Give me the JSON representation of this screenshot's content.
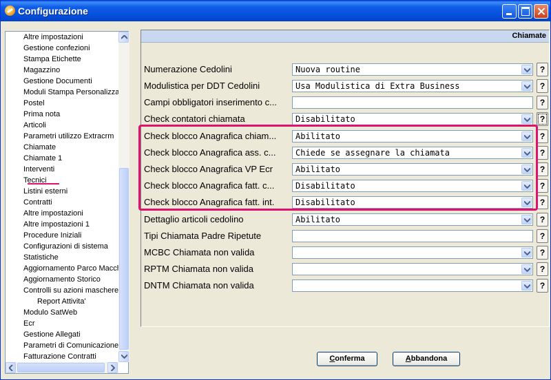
{
  "window": {
    "title": "Configurazione",
    "icon": "app-icon"
  },
  "tree": {
    "items": [
      {
        "label": "Altre impostazioni"
      },
      {
        "label": "Gestione confezioni"
      },
      {
        "label": "Stampa Etichette"
      },
      {
        "label": "Magazzino"
      },
      {
        "label": "Gestione Documenti"
      },
      {
        "label": "Moduli Stampa Personalizzat"
      },
      {
        "label": "Postel"
      },
      {
        "label": "Prima nota"
      },
      {
        "label": "Articoli"
      },
      {
        "label": "Parametri utilizzo Extracrm"
      },
      {
        "label": "Chiamate"
      },
      {
        "label": "Chiamate 1"
      },
      {
        "label": "Interventi"
      },
      {
        "label": "Tecnici"
      },
      {
        "label": "Listini esterni"
      },
      {
        "label": "Contratti"
      },
      {
        "label": "Altre impostazioni"
      },
      {
        "label": "Altre impostazioni 1"
      },
      {
        "label": "Procedure Iniziali"
      },
      {
        "label": "Configurazioni di sistema"
      },
      {
        "label": "Statistiche"
      },
      {
        "label": "Aggiornamento Parco Macch"
      },
      {
        "label": "Aggiornamento Storico"
      },
      {
        "label": "Controlli su azioni maschere"
      },
      {
        "label": "Report Attivita'"
      },
      {
        "label": "Modulo SatWeb"
      },
      {
        "label": "Ecr"
      },
      {
        "label": "Gestione Allegati"
      },
      {
        "label": "Parametri di Comunicazione"
      },
      {
        "label": "Fatturazione Contratti"
      }
    ]
  },
  "panel": {
    "title": "Chiamate",
    "rows": [
      {
        "label": "Numerazione Cedolini",
        "value": "Nuova routine",
        "type": "dropdown"
      },
      {
        "label": "Modulistica per DDT Cedolini",
        "value": "Usa Modulistica di Extra Business",
        "type": "dropdown"
      },
      {
        "label": "Campi obbligatori inserimento c...",
        "value": "",
        "type": "text"
      },
      {
        "label": "Check contatori chiamata",
        "value": "Disabilitato",
        "type": "dropdown"
      },
      {
        "label": "Check blocco Anagrafica chiam...",
        "value": "Abilitato",
        "type": "dropdown"
      },
      {
        "label": "Check blocco Anagrafica ass. c...",
        "value": "Chiede se assegnare la chiamata",
        "type": "dropdown"
      },
      {
        "label": "Check blocco Anagrafica VP Ecr",
        "value": "Abilitato",
        "type": "dropdown"
      },
      {
        "label": "Check blocco Anagrafica fatt. c...",
        "value": "Disabilitato",
        "type": "dropdown"
      },
      {
        "label": "Check blocco Anagrafica fatt. int.",
        "value": "Disabilitato",
        "type": "dropdown"
      },
      {
        "label": "Dettaglio articoli cedolino",
        "value": "Abilitato",
        "type": "dropdown"
      },
      {
        "label": "Tipi Chiamata Padre Ripetute",
        "value": "",
        "type": "text"
      },
      {
        "label": "MCBC Chiamata non valida",
        "value": "",
        "type": "dropdown"
      },
      {
        "label": "RPTM Chiamata non valida",
        "value": "",
        "type": "dropdown"
      },
      {
        "label": "DNTM Chiamata non valida",
        "value": "",
        "type": "dropdown"
      }
    ],
    "help_label": "?"
  },
  "buttons": {
    "confirm": {
      "prefix": "C",
      "rest": "onferma"
    },
    "cancel": {
      "prefix": "A",
      "rest": "bbandona"
    }
  },
  "colors": {
    "highlight": "#e0116e",
    "titlebar": "#0550dc"
  }
}
